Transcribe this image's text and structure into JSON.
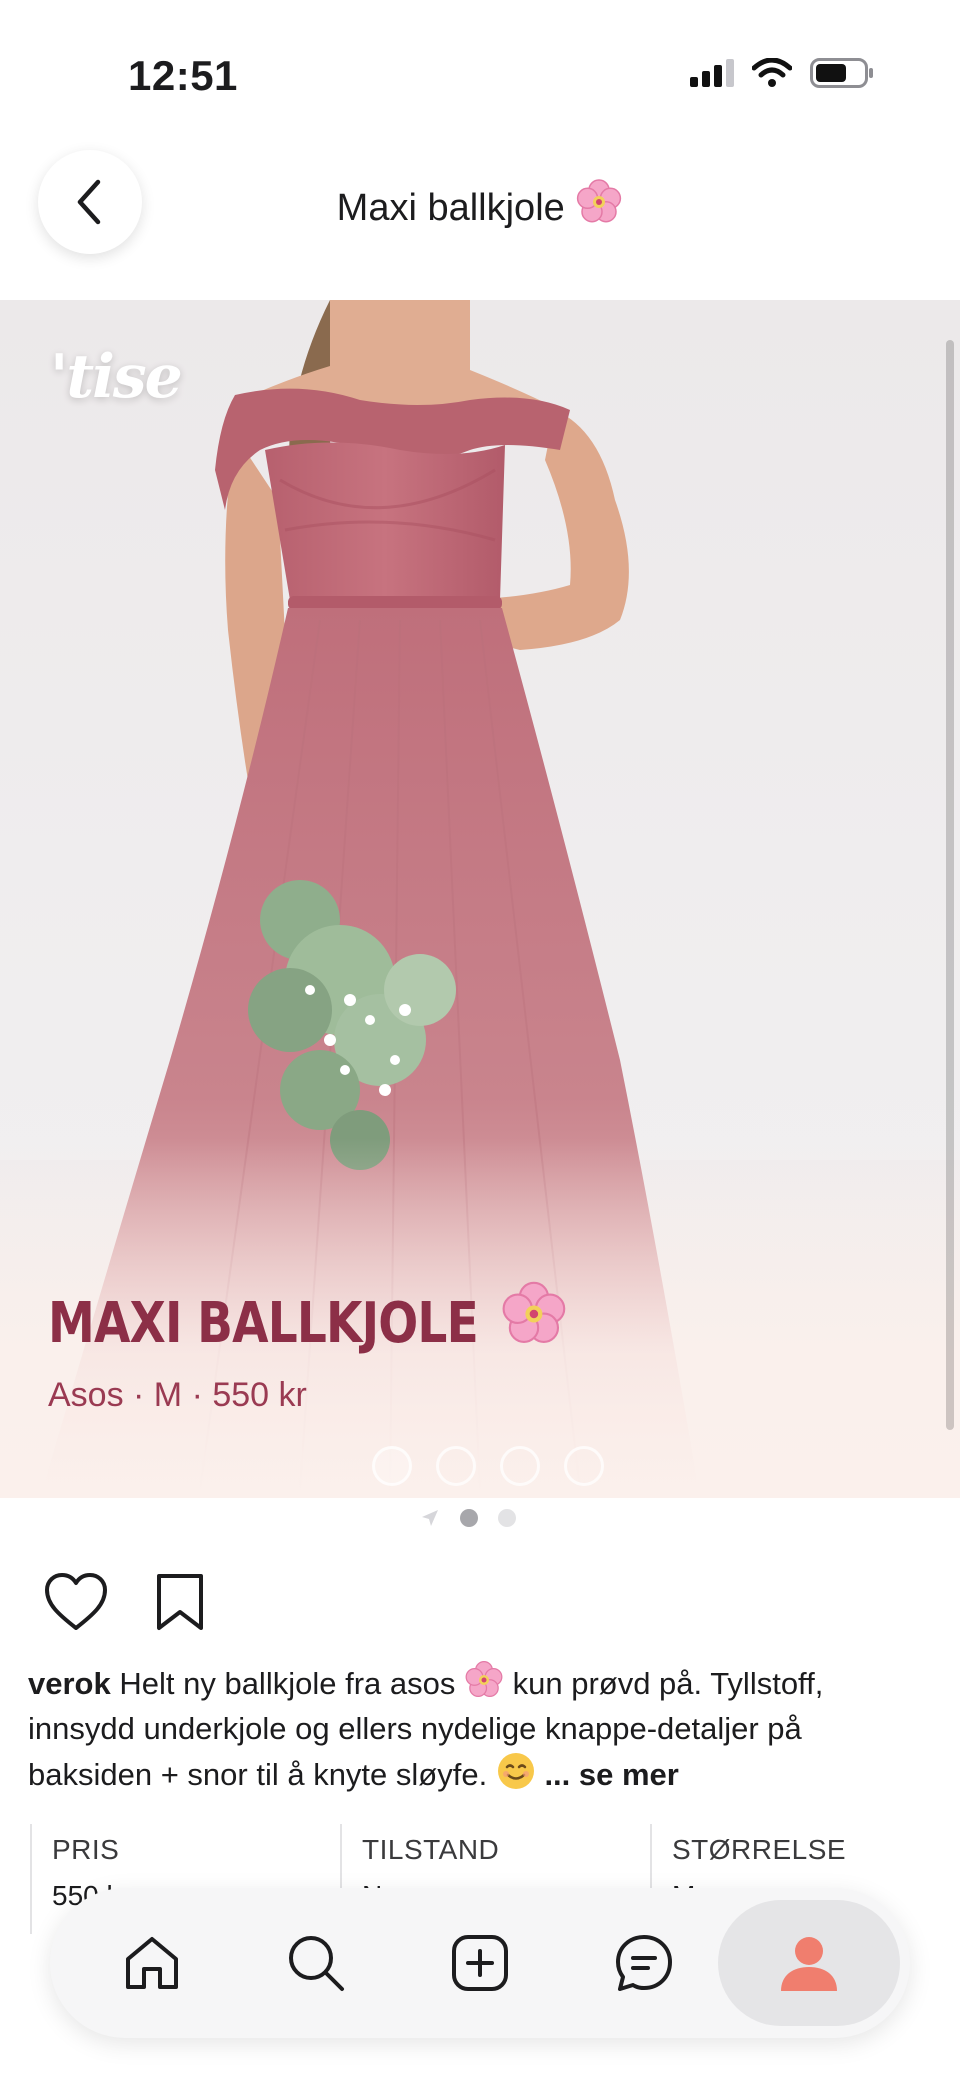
{
  "status_bar": {
    "time": "12:51",
    "icons": [
      "cellular-signal-icon",
      "wifi-icon",
      "battery-icon"
    ]
  },
  "header": {
    "title": "Maxi ballkjole",
    "title_emoji": "cherry-blossom-icon",
    "back_icon": "chevron-left-icon"
  },
  "hero": {
    "brand_logo": "'tise",
    "title": "MAXI BALLKJOLE",
    "title_emoji": "cherry-blossom-icon",
    "subtitle": "Asos · M · 550 kr",
    "image_count": 4,
    "active_image": 1
  },
  "page_indicator": {
    "count": 2,
    "active": 1
  },
  "actions": {
    "like_icon": "heart-icon",
    "save_icon": "bookmark-icon"
  },
  "caption": {
    "username": "verok",
    "text_part1": "Helt ny ballkjole fra asos",
    "text_part2": "kun prøvd på. Tyllstoff, innsydd underkjole og ellers nydelige knappe-detaljer på baksiden + snor til å knyte sløyfe.",
    "more_label": "... se mer"
  },
  "info": [
    {
      "label": "PRIS",
      "value": "550 kr"
    },
    {
      "label": "TILSTAND",
      "value": "Ny"
    },
    {
      "label": "STØRRELSE",
      "value": "M"
    }
  ],
  "bottom_nav": {
    "items": [
      "home-icon",
      "search-icon",
      "add-listing-icon",
      "messages-icon",
      "profile-icon"
    ],
    "active": "profile-icon"
  },
  "colors": {
    "accent": "#f07e6e",
    "hero_title": "#8c2f47",
    "dress": "#c77783"
  }
}
